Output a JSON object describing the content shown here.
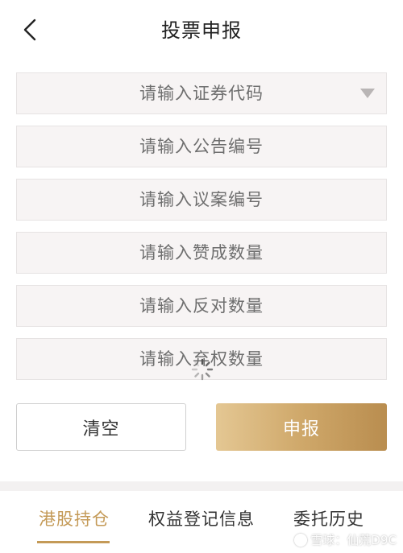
{
  "header": {
    "title": "投票申报"
  },
  "form": {
    "security_code_placeholder": "请输入证券代码",
    "announcement_no_placeholder": "请输入公告编号",
    "proposal_no_placeholder": "请输入议案编号",
    "approve_qty_placeholder": "请输入赞成数量",
    "oppose_qty_placeholder": "请输入反对数量",
    "abstain_qty_placeholder": "请输入弃权数量"
  },
  "buttons": {
    "clear_label": "清空",
    "submit_label": "申报"
  },
  "tabs": [
    {
      "label": "港股持仓"
    },
    {
      "label": "权益登记信息"
    },
    {
      "label": "委托历史"
    }
  ],
  "watermark": {
    "text": "雪球：仙荒D9C"
  },
  "colors": {
    "accent": "#c49a57",
    "field_bg": "#f7f4f4",
    "submit_gradient_start": "#e4c793",
    "submit_gradient_end": "#b98d4f"
  }
}
